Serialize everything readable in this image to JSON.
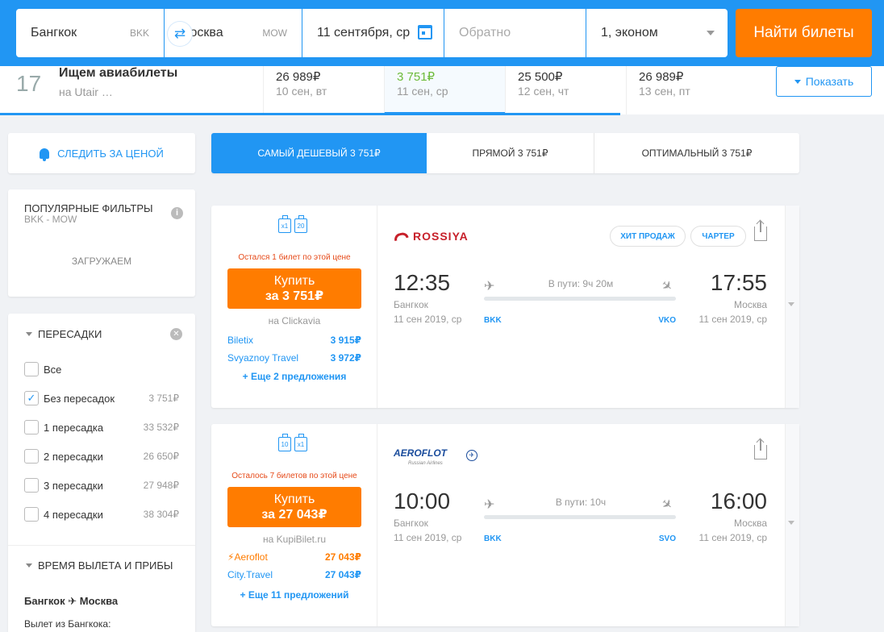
{
  "search": {
    "from": "Бангкок",
    "from_code": "BKK",
    "to": "Москва",
    "to_code": "MOW",
    "date": "11 сентября, ср",
    "return_placeholder": "Обратно",
    "passengers": "1, эконом",
    "find_label": "Найти билеты"
  },
  "strip": {
    "ad_day": "17",
    "ad_title": "Ищем авиабилеты",
    "ad_sub": "на Utair …",
    "dates": [
      {
        "price": "26 989₽",
        "date": "10 сен, вт"
      },
      {
        "price": "3 751₽",
        "date": "11 сен, ср"
      },
      {
        "price": "25 500₽",
        "date": "12 сен, чт"
      },
      {
        "price": "26 989₽",
        "date": "13 сен, пт"
      }
    ],
    "show_label": "Показать"
  },
  "sidebar": {
    "watch_label": "СЛЕДИТЬ ЗА ЦЕНОЙ",
    "popular_title": "ПОПУЛЯРНЫЕ ФИЛЬТРЫ",
    "popular_sub": "BKK - MOW",
    "loading": "ЗАГРУЖАЕМ",
    "transfers_title": "ПЕРЕСАДКИ",
    "transfers": [
      {
        "label": "Все",
        "price": "",
        "checked": false
      },
      {
        "label": "Без пересадок",
        "price": "3 751₽",
        "checked": true
      },
      {
        "label": "1 пересадка",
        "price": "33 532₽",
        "checked": false
      },
      {
        "label": "2 пересадки",
        "price": "26 650₽",
        "checked": false
      },
      {
        "label": "3 пересадки",
        "price": "27 948₽",
        "checked": false
      },
      {
        "label": "4 пересадки",
        "price": "38 304₽",
        "checked": false
      }
    ],
    "time_title": "ВРЕМЯ ВЫЛЕТА И ПРИБЫ",
    "route_from": "Бангкок",
    "route_to": "Москва",
    "departure_label": "Вылет из Бангкока:"
  },
  "tabs": [
    {
      "label": "САМЫЙ ДЕШЕВЫЙ 3 751₽"
    },
    {
      "label": "ПРЯМОЙ 3 751₽"
    },
    {
      "label": "ОПТИМАЛЬНЫЙ 3 751₽"
    }
  ],
  "tickets": [
    {
      "bags": [
        "x1",
        "20"
      ],
      "left_note": "Остался 1 билет по этой цене",
      "buy_line1": "Купить",
      "buy_line2": "за 3 751₽",
      "via": "на Clickavia",
      "offers": [
        {
          "name": "Biletix",
          "price": "3 915₽"
        },
        {
          "name": "Svyaznoy Travel",
          "price": "3 972₽"
        }
      ],
      "more": "+ Еще 2 предложения",
      "airline": "ROSSIYA",
      "badges": [
        "ХИТ ПРОДАЖ",
        "ЧАРТЕР"
      ],
      "dep_time": "12:35",
      "arr_time": "17:55",
      "dep_city": "Бангкок",
      "arr_city": "Москва",
      "dep_date": "11 сен 2019, ср",
      "arr_date": "11 сен 2019, ср",
      "duration": "В пути: 9ч 20м",
      "dep_iata": "BKK",
      "arr_iata": "VKO"
    },
    {
      "bags": [
        "10",
        "x1"
      ],
      "left_note": "Осталось 7 билетов по этой цене",
      "buy_line1": "Купить",
      "buy_line2": "за 27 043₽",
      "via": "на KupiBilet.ru",
      "offers": [
        {
          "name": "Aeroflot",
          "price": "27 043₽"
        },
        {
          "name": "City.Travel",
          "price": "27 043₽"
        }
      ],
      "more": "+ Еще 11 предложений",
      "airline": "AEROFLOT",
      "airline_sub": "Russian Airlines",
      "dep_time": "10:00",
      "arr_time": "16:00",
      "dep_city": "Бангкок",
      "arr_city": "Москва",
      "dep_date": "11 сен 2019, ср",
      "arr_date": "11 сен 2019, ср",
      "duration": "В пути: 10ч",
      "dep_iata": "BKK",
      "arr_iata": "SVO"
    }
  ]
}
